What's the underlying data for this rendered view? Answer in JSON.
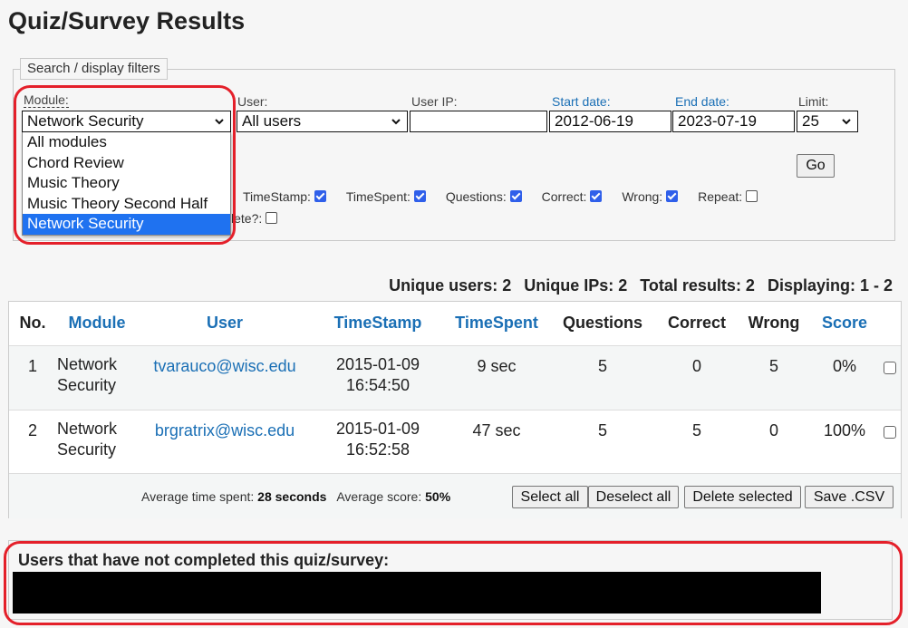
{
  "page": {
    "title": "Quiz/Survey Results"
  },
  "filters": {
    "legend": "Search / display filters",
    "module": {
      "label": "Module:",
      "value": "Network Security",
      "options": [
        "All modules",
        "Chord Review",
        "Music Theory",
        "Music Theory Second Half",
        "Network Security"
      ],
      "highlighted": "Network Security"
    },
    "user": {
      "label": "User:",
      "value": "All users"
    },
    "user_ip": {
      "label": "User IP:",
      "value": ""
    },
    "start_date": {
      "label": "Start date:",
      "value": "2012-06-19"
    },
    "end_date": {
      "label": "End date:",
      "value": "2023-07-19"
    },
    "limit": {
      "label": "Limit:",
      "value": "25"
    },
    "go_label": "Go",
    "columns": [
      {
        "label": "TimeStamp:",
        "checked": true
      },
      {
        "label": "TimeSpent:",
        "checked": true
      },
      {
        "label": "Questions:",
        "checked": true
      },
      {
        "label": "Correct:",
        "checked": true
      },
      {
        "label": "Wrong:",
        "checked": true
      },
      {
        "label": "Repeat:",
        "checked": false
      }
    ],
    "delete_partial": {
      "label": "lete?:",
      "checked": false
    }
  },
  "summary": {
    "unique_users": "Unique users: 2",
    "unique_ips": "Unique IPs: 2",
    "total_results": "Total results: 2",
    "displaying": "Displaying: 1 - 2"
  },
  "table": {
    "headers": [
      "No.",
      "Module",
      "User",
      "TimeStamp",
      "TimeSpent",
      "Questions",
      "Correct",
      "Wrong",
      "Score"
    ],
    "rows": [
      {
        "no": "1",
        "module_1": "Network",
        "module_2": "Security",
        "user": "tvarauco@wisc.edu",
        "date": "2015-01-09",
        "time": "16:54:50",
        "spent": "9 sec",
        "questions": "5",
        "correct": "0",
        "wrong": "5",
        "score": "0%",
        "selected": false
      },
      {
        "no": "2",
        "module_1": "Network",
        "module_2": "Security",
        "user": "brgratrix@wisc.edu",
        "date": "2015-01-09",
        "time": "16:52:58",
        "spent": "47 sec",
        "questions": "5",
        "correct": "5",
        "wrong": "0",
        "score": "100%",
        "selected": false
      }
    ],
    "footer": {
      "avg_time_label": "Average time spent:",
      "avg_time_value": "28 seconds",
      "avg_score_label": "Average score:",
      "avg_score_value": "50%",
      "buttons": [
        "Select all",
        "Deselect all",
        "Delete selected",
        "Save .CSV"
      ]
    }
  },
  "not_completed": {
    "title": "Users that have not completed this quiz/survey:",
    "content": "[redacted]"
  },
  "colors": {
    "link": "#1a6fb5",
    "highlight": "#1f72f0",
    "annotation": "#e4202a",
    "checkbox": "#2f5fea"
  }
}
